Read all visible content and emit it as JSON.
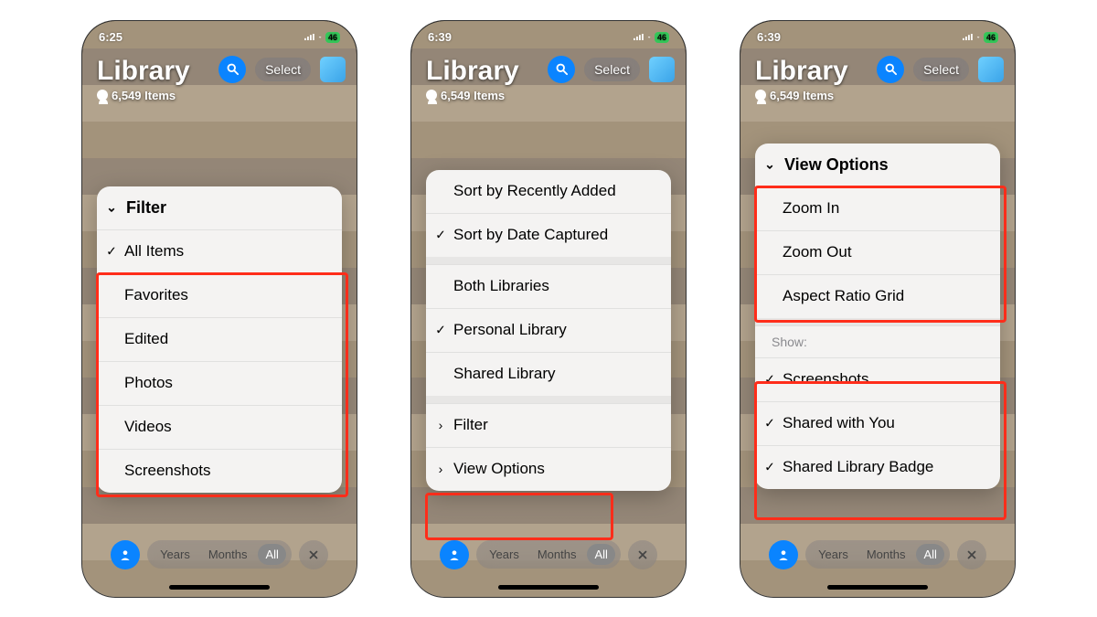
{
  "status": {
    "bat": "46"
  },
  "screens": [
    {
      "time": "6:25",
      "header": {
        "title": "Library",
        "subtitle": "6,549 Items",
        "select": "Select"
      },
      "menu": {
        "header": "Filter",
        "rows": [
          {
            "label": "All Items",
            "check": true
          },
          {
            "label": "Favorites"
          },
          {
            "label": "Edited"
          },
          {
            "label": "Photos"
          },
          {
            "label": "Videos"
          },
          {
            "label": "Screenshots"
          }
        ]
      },
      "bottom": {
        "items": [
          "Years",
          "Months",
          "All"
        ],
        "sel": 2
      }
    },
    {
      "time": "6:39",
      "header": {
        "title": "Library",
        "subtitle": "6,549 Items",
        "select": "Select"
      },
      "menu": {
        "groups": [
          [
            {
              "label": "Sort by Recently Added"
            },
            {
              "label": "Sort by Date Captured",
              "check": true
            }
          ],
          [
            {
              "label": "Both Libraries"
            },
            {
              "label": "Personal Library",
              "check": true
            },
            {
              "label": "Shared Library"
            }
          ],
          [
            {
              "label": "Filter",
              "chev": true
            },
            {
              "label": "View Options",
              "chev": true
            }
          ]
        ]
      },
      "bottom": {
        "items": [
          "Years",
          "Months",
          "All"
        ],
        "sel": 2
      }
    },
    {
      "time": "6:39",
      "header": {
        "title": "Library",
        "subtitle": "6,549 Items",
        "select": "Select"
      },
      "menu": {
        "header": "View Options",
        "top": [
          {
            "label": "Zoom In"
          },
          {
            "label": "Zoom Out"
          },
          {
            "label": "Aspect Ratio Grid"
          }
        ],
        "sectionLabel": "Show:",
        "bottomRows": [
          {
            "label": "Screenshots",
            "check": true
          },
          {
            "label": "Shared with You",
            "check": true
          },
          {
            "label": "Shared Library Badge",
            "check": true
          }
        ]
      },
      "bottom": {
        "items": [
          "Years",
          "Months",
          "All"
        ],
        "sel": 2
      }
    }
  ]
}
